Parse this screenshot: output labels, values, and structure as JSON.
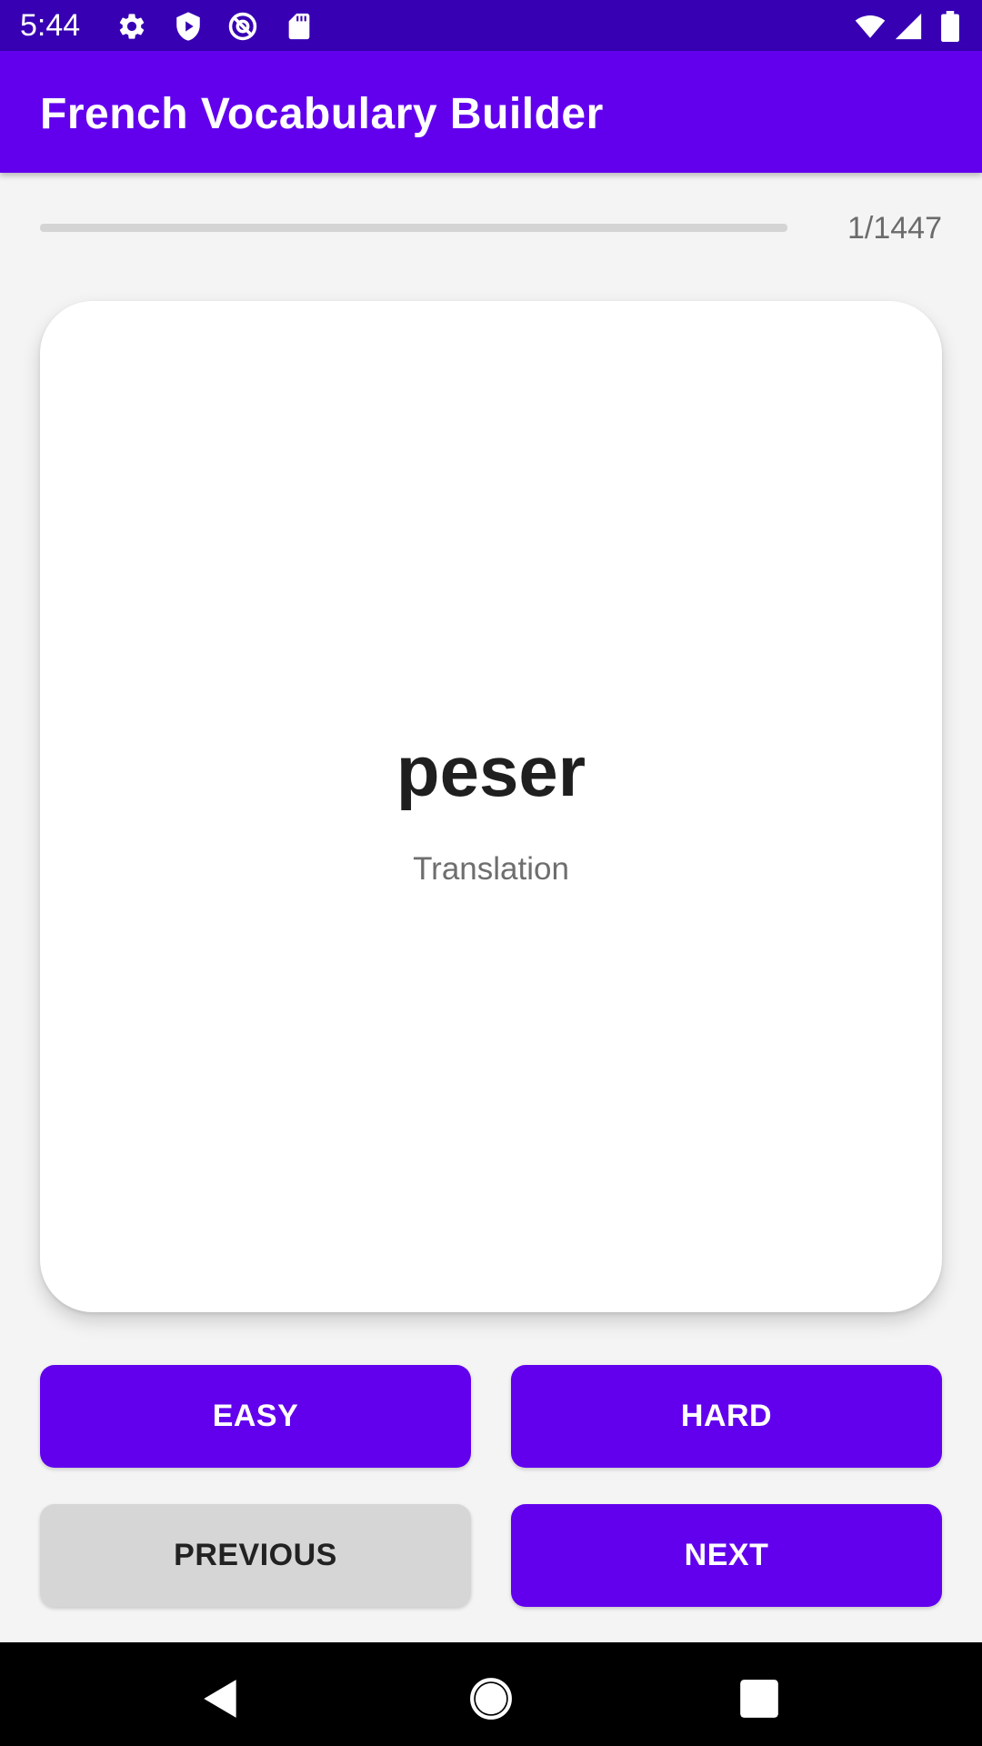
{
  "status_bar": {
    "time": "5:44",
    "icons": [
      "settings-icon",
      "shield-play-icon",
      "at-sign-icon",
      "sd-card-icon",
      "wifi-icon",
      "signal-icon",
      "battery-icon"
    ]
  },
  "app_bar": {
    "title": "French Vocabulary Builder"
  },
  "progress": {
    "current": 1,
    "total": 1447,
    "label": "1/1447"
  },
  "card": {
    "word": "peser",
    "translation": "Translation"
  },
  "buttons": {
    "easy": "EASY",
    "hard": "HARD",
    "previous": "PREVIOUS",
    "next": "NEXT"
  },
  "nav_bar": {
    "icons": [
      "back-icon",
      "home-icon",
      "recents-icon"
    ]
  },
  "colors": {
    "status_bar": "#3700b3",
    "primary": "#6200ee",
    "background": "#f4f4f4",
    "secondary_button": "#d6d6d6"
  }
}
